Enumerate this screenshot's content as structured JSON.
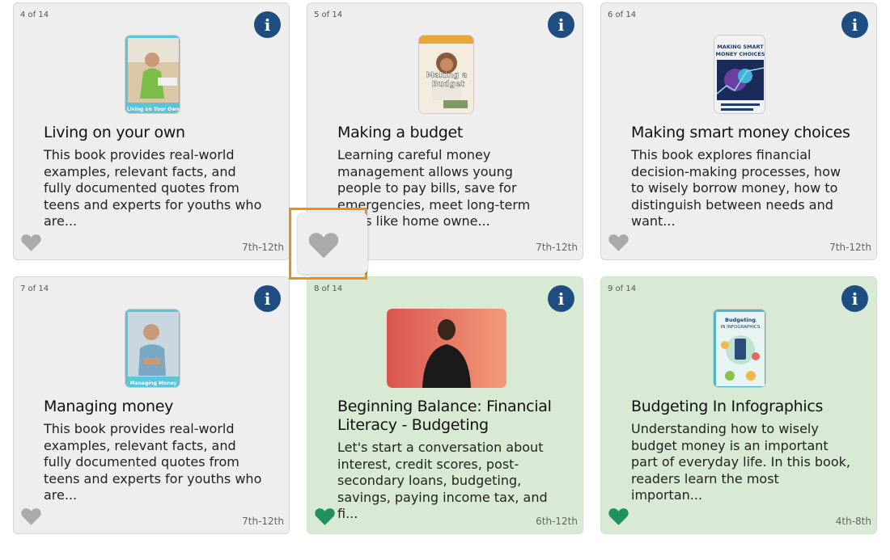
{
  "colors": {
    "card_gray": "#eeeeee",
    "card_green": "#d8ead3",
    "info_blue": "#1e4d82",
    "heart_gray": "#aaaaaa",
    "heart_green": "#1e9160",
    "highlight_orange": "#f28a1e"
  },
  "cards": [
    {
      "counter": "4 of 14",
      "title": "Living on your own",
      "description": "This book provides real-world examples, relevant facts, and fully documented quotes from teens and experts for youths who are...",
      "grade": "7th-12th",
      "favorited": false,
      "cover_text": "Living on Your Own",
      "icon": "heart-icon"
    },
    {
      "counter": "5 of 14",
      "title": "Making a budget",
      "description": "Learning careful money management allows young people to pay bills, save for emergencies, meet long-term goals like home owne...",
      "grade": "7th-12th",
      "favorited": false,
      "cover_text": "Making a Budget",
      "icon": "heart-icon"
    },
    {
      "counter": "6 of 14",
      "title": "Making smart money choices",
      "description": "This book explores financial decision-making processes, how to wisely borrow money, how to distinguish between needs and want...",
      "grade": "7th-12th",
      "favorited": false,
      "cover_text": "MAKING SMART MONEY CHOICES",
      "icon": "heart-icon"
    },
    {
      "counter": "7 of 14",
      "title": "Managing money",
      "description": "This book provides real-world examples, relevant facts, and fully documented quotes from teens and experts for youths who are...",
      "grade": "7th-12th",
      "favorited": false,
      "cover_text": "Managing Money",
      "icon": "heart-icon"
    },
    {
      "counter": "8 of 14",
      "title": "Beginning Balance: Financial Literacy - Budgeting",
      "description": "Let's start a conversation about interest, credit scores, post-secondary loans, budgeting, savings, paying income tax, and fi...",
      "grade": "6th-12th",
      "favorited": true,
      "icon": "heart-icon"
    },
    {
      "counter": "9 of 14",
      "title": "Budgeting In Infographics",
      "description": "Understanding how to wisely budget money is an important part of everyday life. In this book, readers learn the most importan...",
      "grade": "4th-8th",
      "favorited": true,
      "cover_text": "Budgeting In Infographics",
      "icon": "heart-icon"
    }
  ]
}
